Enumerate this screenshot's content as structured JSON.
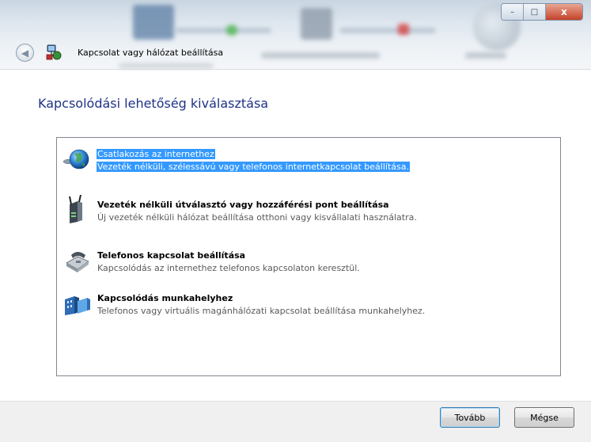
{
  "window": {
    "title": "Kapcsolat vagy hálózat beállítása",
    "controls": {
      "minimize": "–",
      "maximize": "□",
      "close": "x"
    }
  },
  "page": {
    "heading": "Kapcsolódási lehetőség kiválasztása"
  },
  "options": [
    {
      "title": "Csatlakozás az internethez",
      "description": "Vezeték nélküli, szélessávú vagy telefonos internetkapcsolat beállítása.",
      "icon": "globe-icon",
      "selected": true
    },
    {
      "title": "Vezeték nélküli útválasztó vagy hozzáférési pont beállítása",
      "description": "Új vezeték nélküli hálózat beállítása otthoni vagy kisvállalati használatra.",
      "icon": "wireless-router-icon",
      "selected": false
    },
    {
      "title": "Telefonos kapcsolat beállítása",
      "description": "Kapcsolódás az internethez telefonos kapcsolaton keresztül.",
      "icon": "dialup-phone-icon",
      "selected": false
    },
    {
      "title": "Kapcsolódás munkahelyhez",
      "description": "Telefonos vagy virtuális magánhálózati kapcsolat beállítása munkahelyhez.",
      "icon": "workplace-network-icon",
      "selected": false
    }
  ],
  "buttons": {
    "next": "Tovább",
    "cancel": "Mégse"
  },
  "colors": {
    "selection": "#3399ff",
    "heading": "#1e3287"
  }
}
